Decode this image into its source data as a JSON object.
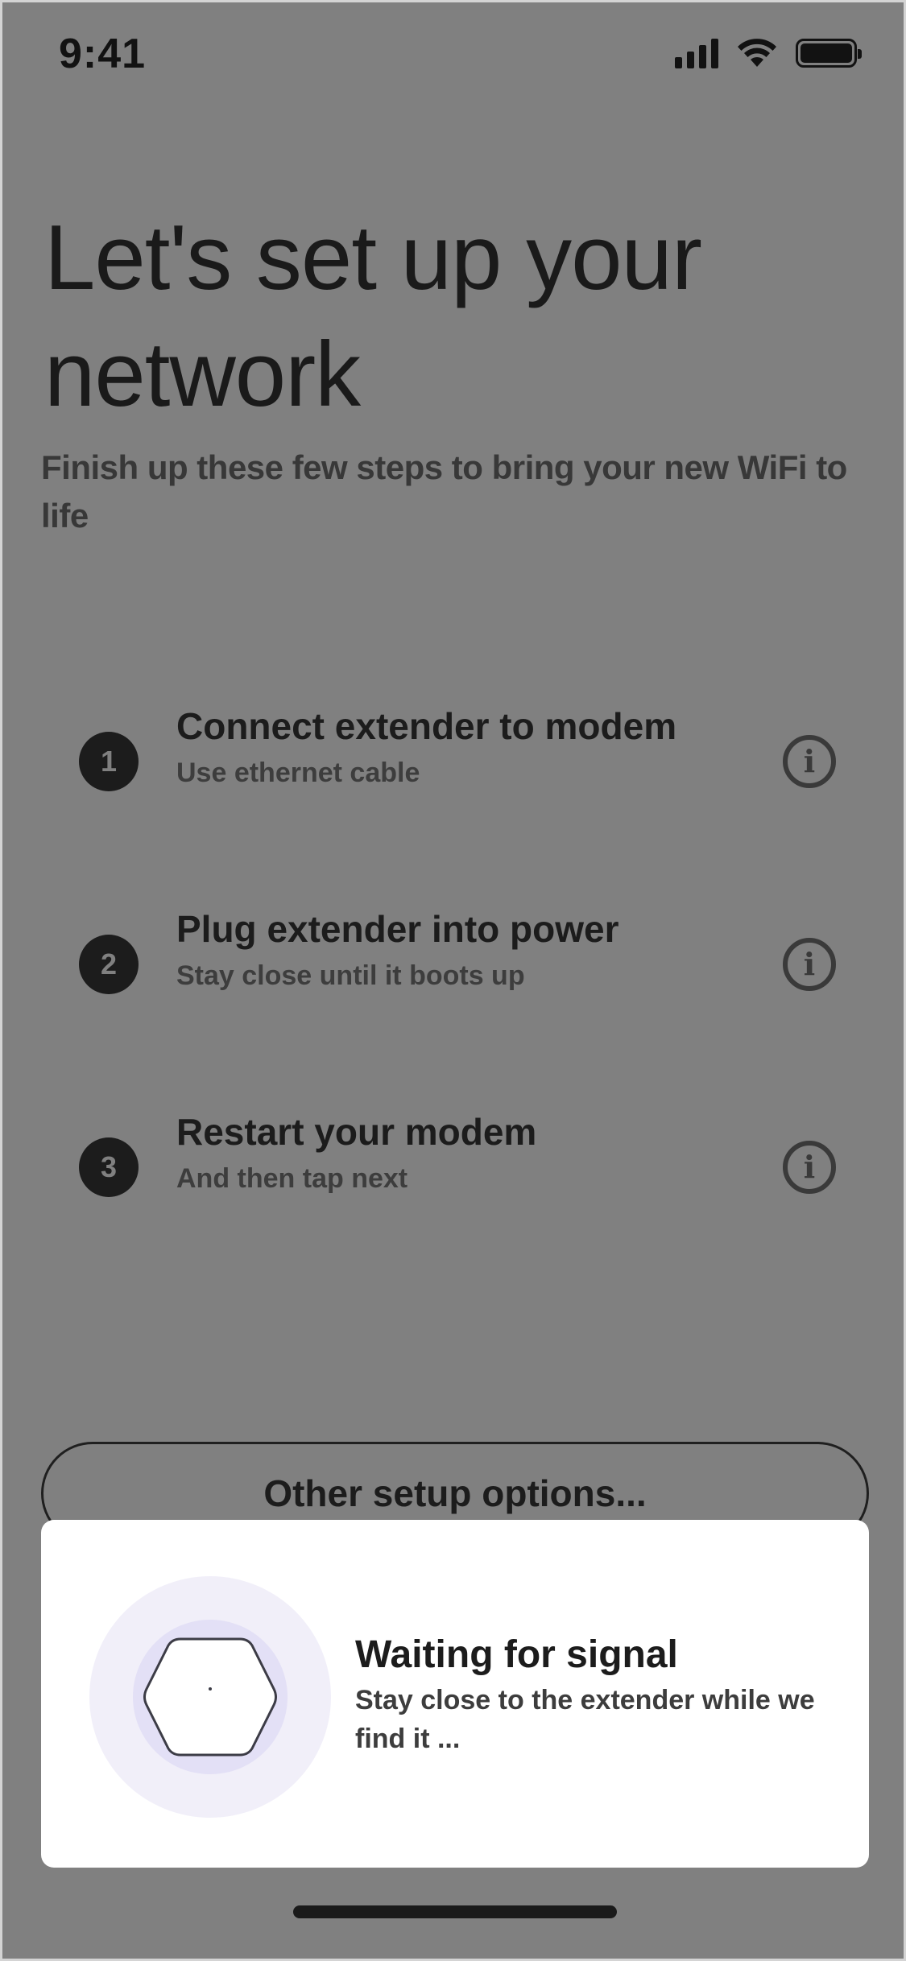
{
  "status_bar": {
    "time": "9:41",
    "icons": [
      "signal-icon",
      "wifi-icon",
      "battery-icon"
    ]
  },
  "header": {
    "title": "Let's set up your network",
    "subtitle": "Finish up these few steps to bring your new WiFi to life"
  },
  "steps": [
    {
      "number": "1",
      "title": "Connect extender to modem",
      "subtitle": "Use ethernet cable",
      "icon": "info-icon"
    },
    {
      "number": "2",
      "title": "Plug extender into power",
      "subtitle": "Stay close until it boots up",
      "icon": "info-icon"
    },
    {
      "number": "3",
      "title": "Restart your modem",
      "subtitle": "And then tap next",
      "icon": "info-icon"
    }
  ],
  "other_options": {
    "label": "Other setup options..."
  },
  "signal_card": {
    "title": "Waiting for signal",
    "subtitle": "Stay close to the extender while we find it ...",
    "icon": "extender-device-icon"
  },
  "colors": {
    "overlay_background": "#808080",
    "card_background": "#ffffff",
    "halo_outer": "#f1eff9",
    "halo_inner": "#e3e0f6",
    "text_primary": "#1c1c1c"
  }
}
